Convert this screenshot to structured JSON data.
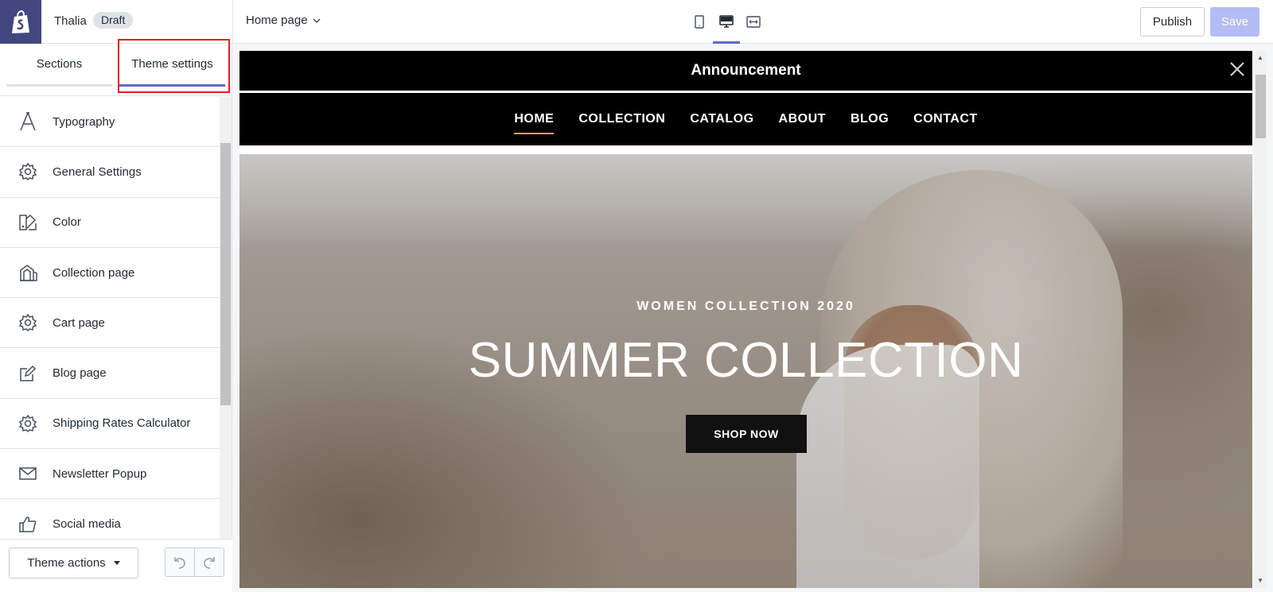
{
  "topbar": {
    "store_name": "Thalia",
    "badge": "Draft",
    "page_select": "Home page",
    "publish_label": "Publish",
    "save_label": "Save"
  },
  "sidebar": {
    "tabs": [
      {
        "label": "Sections",
        "active": false
      },
      {
        "label": "Theme settings",
        "active": true
      }
    ],
    "items": [
      {
        "label": "Typography",
        "icon": "typography-icon"
      },
      {
        "label": "General Settings",
        "icon": "gear-icon"
      },
      {
        "label": "Color",
        "icon": "color-icon"
      },
      {
        "label": "Collection page",
        "icon": "collection-icon"
      },
      {
        "label": "Cart page",
        "icon": "gear-icon"
      },
      {
        "label": "Blog page",
        "icon": "edit-icon"
      },
      {
        "label": "Shipping Rates Calculator",
        "icon": "gear-icon"
      },
      {
        "label": "Newsletter Popup",
        "icon": "envelope-icon"
      },
      {
        "label": "Social media",
        "icon": "thumbs-up-icon"
      }
    ],
    "footer": {
      "theme_actions_label": "Theme actions"
    }
  },
  "preview": {
    "announcement": "Announcement",
    "nav": [
      "HOME",
      "COLLECTION",
      "CATALOG",
      "ABOUT",
      "BLOG",
      "CONTACT"
    ],
    "active_nav": "HOME",
    "hero": {
      "eyebrow": "WOMEN COLLECTION 2020",
      "title": "SUMMER COLLECTION",
      "cta": "SHOP NOW"
    }
  },
  "colors": {
    "accent": "#5c6ac4",
    "highlight": "#e31e25",
    "nav_underline": "#e8a44c",
    "logo_bg": "#43467f"
  }
}
